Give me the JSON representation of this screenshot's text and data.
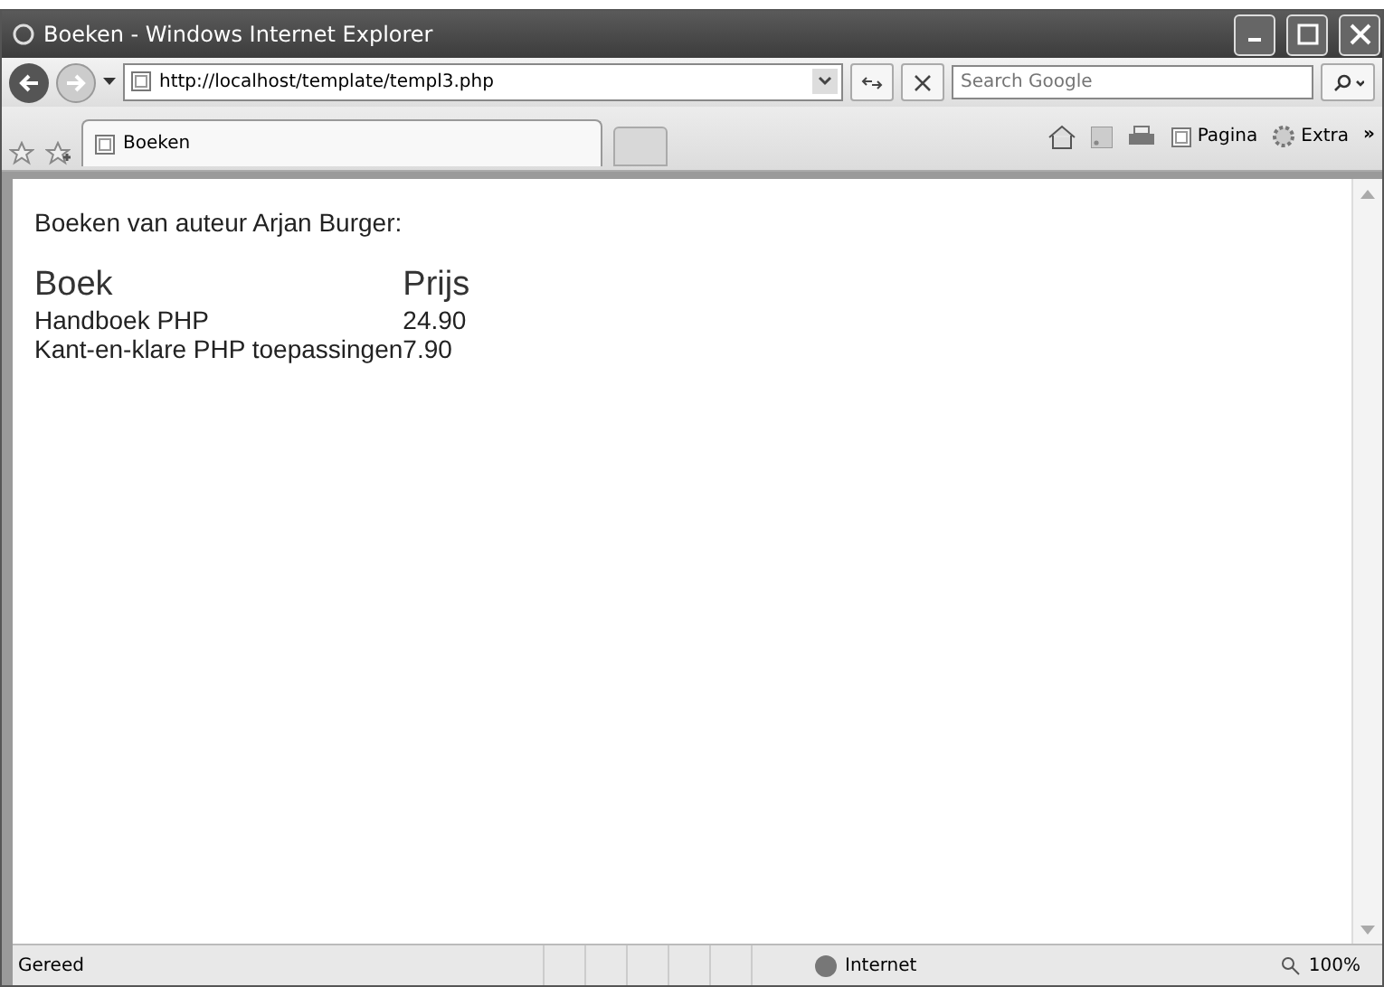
{
  "window": {
    "title": "Boeken - Windows Internet Explorer"
  },
  "address_bar": {
    "value": "http://localhost/template/templ3.php"
  },
  "search": {
    "placeholder": "Search Google"
  },
  "tabs": [
    {
      "label": "Boeken",
      "selected": true
    }
  ],
  "toolbar": {
    "page_menu": "Pagina",
    "tools_menu": "Extra",
    "overflow": "»"
  },
  "content": {
    "heading": "Boeken van auteur Arjan Burger:",
    "table": {
      "columns": [
        "Boek",
        "Prijs"
      ],
      "rows": [
        [
          "Handboek PHP",
          "24.90"
        ],
        [
          "Kant-en-klare PHP toepassingen",
          "7.90"
        ]
      ]
    }
  },
  "status_bar": {
    "status": "Gereed",
    "zone": "Internet",
    "zoom": "100%"
  }
}
